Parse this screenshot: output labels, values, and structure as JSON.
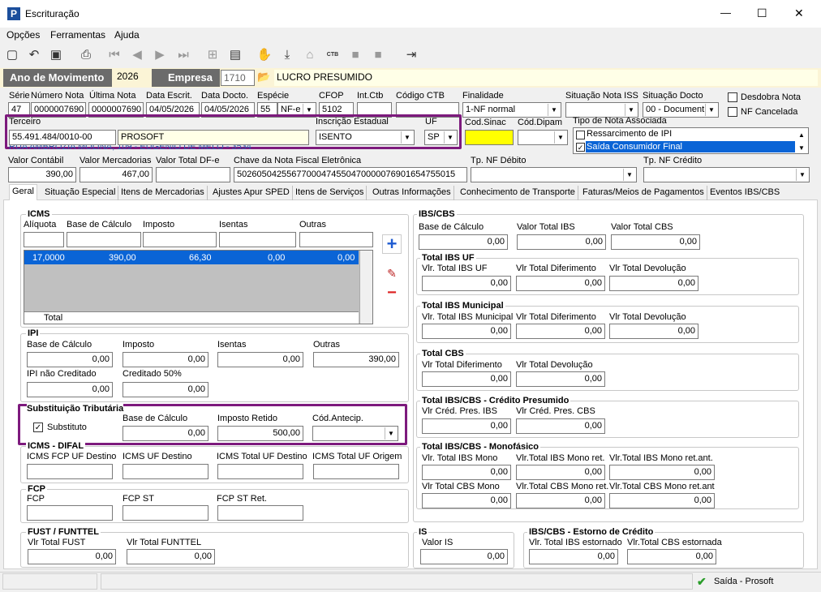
{
  "window": {
    "title": "Escrituração",
    "app_letter": "P",
    "min": "—",
    "max": "☐",
    "close": "✕"
  },
  "menu": [
    "Opções",
    "Ferramentas",
    "Ajuda"
  ],
  "toolbar": {
    "icons": [
      "new-icon",
      "undo-icon",
      "save-icon",
      "preview-icon",
      "first-icon",
      "prev-icon",
      "next-icon",
      "last-icon",
      "tree-icon",
      "report-icon",
      "hand-icon",
      "import-icon",
      "house-icon",
      "ctb-icon",
      "stop-icon",
      "exit-icon"
    ],
    "ctb": "CTB"
  },
  "header": {
    "ano_label": "Ano de Movimento",
    "ano": "2026",
    "empresa_label": "Empresa",
    "empresa_code": "1710",
    "empresa_name": "LUCRO PRESUMIDO"
  },
  "row1": {
    "serie_label": "Série",
    "serie": "47",
    "numero_label": "Número Nota",
    "numero": "0000007690",
    "ultima_label": "Última Nota",
    "ultima": "0000007690",
    "data_escrit_label": "Data Escrit.",
    "data_escrit": "04/05/2026",
    "data_docto_label": "Data Docto.",
    "data_docto": "04/05/2026",
    "especie_label": "Espécie",
    "especie_code": "55",
    "especie": "NF-e",
    "cfop_label": "CFOP",
    "cfop": "5102",
    "intctb_label": "Int.Ctb",
    "intctb": "",
    "codctb_label": "Código CTB",
    "codctb": "",
    "finalidade_label": "Finalidade",
    "finalidade": "1-NF normal",
    "sitiss_label": "Situação Nota ISS",
    "sitiss": "",
    "sitdocto_label": "Situação Docto",
    "sitdocto": "00 - Document",
    "desdobra": "Desdobra Nota",
    "nfcancelada": "NF Cancelada"
  },
  "row2": {
    "terceiro_label": "Terceiro",
    "terceiro_cnpj": "55.491.484/0010-00",
    "terceiro_nome": "PROSOFT",
    "ie_label": "Inscrição Estadual",
    "ie": "ISENTO",
    "uf_label": "UF",
    "uf": "SP",
    "codsinac_label": "Cod.Sinac",
    "coddipam_label": "Cód.Dipam",
    "tipo_nota_label": "Tipo de Nota Associada",
    "tipo_nota_opts": [
      "Ressarcimento de IPI",
      "Saída Consumidor Final"
    ],
    "address": "RUA AMBRÓZIA MOLINA, 109 - EUGÊNIO DE MELO - 3534"
  },
  "row3": {
    "valor_contabil_label": "Valor Contábil",
    "valor_contabil": "390,00",
    "valor_merc_label": "Valor Mercadorias",
    "valor_merc": "467,00",
    "valor_dfe_label": "Valor Total DF-e",
    "valor_dfe": "",
    "chave_label": "Chave da Nota Fiscal Eletrônica",
    "chave": "50260504255677000474550470000076901654755015",
    "tpdebito_label": "Tp. NF Débito",
    "tpcredito_label": "Tp. NF Crédito"
  },
  "tabs": [
    "Geral",
    "Situação Especial",
    "Itens de Mercadorias",
    "Ajustes Apur SPED",
    "Itens de Serviços",
    "Outras Informações",
    "Conhecimento de Transporte",
    "Faturas/Meios de Pagamentos",
    "Eventos IBS/CBS"
  ],
  "icms": {
    "title": "ICMS",
    "aliquota_label": "Alíquota",
    "base_label": "Base de Cálculo",
    "imposto_label": "Imposto",
    "isentas_label": "Isentas",
    "outras_label": "Outras",
    "row": [
      "17,0000",
      "390,00",
      "66,30",
      "0,00",
      "0,00"
    ],
    "total_label": "Total"
  },
  "ipi": {
    "title": "IPI",
    "base_label": "Base de Cálculo",
    "base": "0,00",
    "imposto_label": "Imposto",
    "imposto": "0,00",
    "isentas_label": "Isentas",
    "isentas": "0,00",
    "outras_label": "Outras",
    "outras": "390,00",
    "naocred_label": "IPI não Creditado",
    "naocred": "0,00",
    "cred50_label": "Creditado 50%",
    "cred50": "0,00"
  },
  "st": {
    "title": "Substituição Tributária",
    "substituto": "Substituto",
    "base_label": "Base de Cálculo",
    "base": "0,00",
    "retido_label": "Imposto Retido",
    "retido": "500,00",
    "antecip_label": "Cód.Antecip."
  },
  "difal": {
    "title": "ICMS - DIFAL",
    "l1": "ICMS FCP UF Destino",
    "l2": "ICMS UF Destino",
    "l3": "ICMS Total UF Destino",
    "l4": "ICMS Total UF Origem"
  },
  "fcp": {
    "title": "FCP",
    "l1": "FCP",
    "l2": "FCP ST",
    "l3": "FCP ST Ret."
  },
  "fust": {
    "title": "FUST / FUNTTEL",
    "l1": "Vlr Total FUST",
    "v1": "0,00",
    "l2": "Vlr Total FUNTTEL",
    "v2": "0,00"
  },
  "ibscbs": {
    "title": "IBS/CBS",
    "base_label": "Base de Cálculo",
    "base": "0,00",
    "ibs_label": "Valor Total IBS",
    "ibs": "0,00",
    "cbs_label": "Valor Total CBS",
    "cbs": "0,00",
    "uf_title": "Total IBS UF",
    "uf_l1": "Vlr. Total IBS UF",
    "uf_l2": "Vlr Total Diferimento",
    "uf_l3": "Vlr Total Devolução",
    "mun_title": "Total IBS Municipal",
    "mun_l1": "Vlr. Total IBS Municipal",
    "mun_l2": "Vlr Total Diferimento",
    "mun_l3": "Vlr Total Devolução",
    "cbs_title": "Total CBS",
    "cbs_l1": "Vlr Total Diferimento",
    "cbs_l2": "Vlr Total Devolução",
    "pres_title": "Total IBS/CBS - Crédito Presumido",
    "pres_l1": "Vlr Créd. Pres. IBS",
    "pres_l2": "Vlr Créd. Pres. CBS",
    "mono_title": "Total IBS/CBS - Monofásico",
    "mono_l1": "Vlr. Total IBS Mono",
    "mono_l2": "Vlr.Total IBS Mono ret.",
    "mono_l3": "Vlr.Total IBS Mono ret.ant.",
    "mono_l4": "Vlr Total CBS Mono",
    "mono_l5": "Vlr.Total CBS Mono ret.",
    "mono_l6": "Vlr.Total CBS Mono ret.ant",
    "zero": "0,00"
  },
  "is": {
    "title": "IS",
    "l1": "Valor IS",
    "v1": "0,00"
  },
  "estorno": {
    "title": "IBS/CBS - Estorno de Crédito",
    "l1": "Vlr. Total IBS estornado",
    "v1": "0,00",
    "l2": "Vlr.Total CBS estornada",
    "v2": "0,00"
  },
  "status": {
    "text": "Saída - Prosoft"
  },
  "colors": {
    "header_bg": "#6b6b6b",
    "highlight": "#7d1a7d",
    "selected": "#0a64d6",
    "yellow": "#ffff00",
    "cream": "#ffffe7"
  }
}
